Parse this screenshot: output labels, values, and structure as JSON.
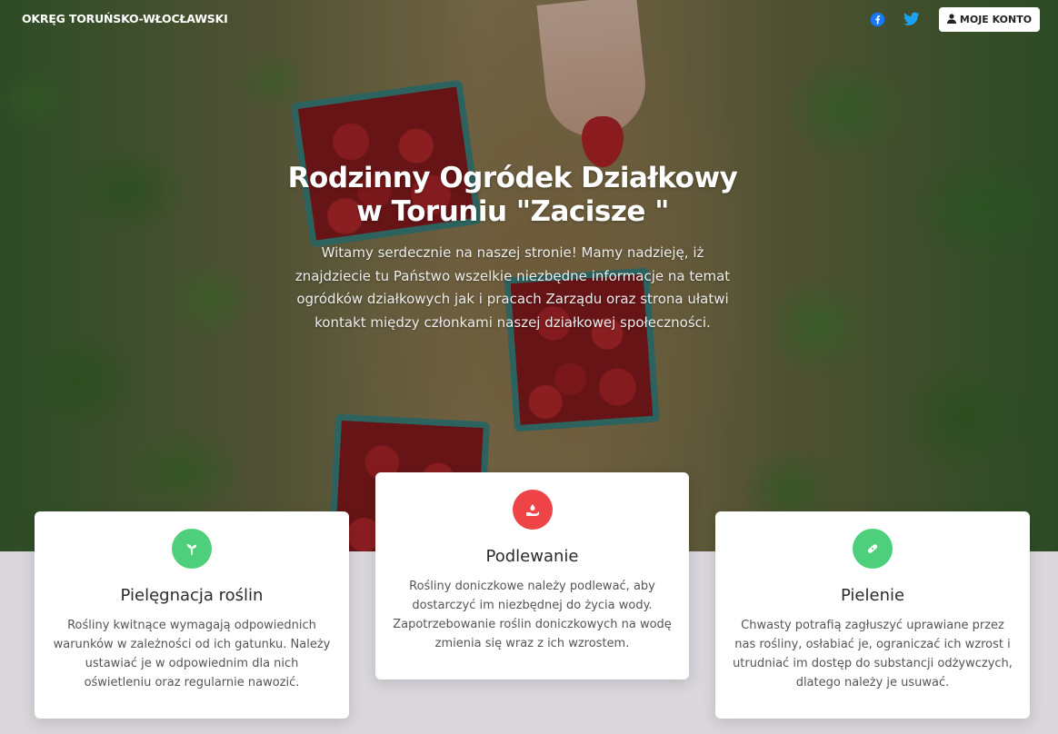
{
  "nav": {
    "brand": "OKRĘG TORUŃSKO-WŁOCŁAWSKI",
    "account_label": "MOJE KONTO",
    "icons": [
      "facebook-icon",
      "twitter-icon",
      "user-icon"
    ],
    "accent_color": "#1877f2",
    "twitter_color": "#1da1f2"
  },
  "hero": {
    "title": "Rodzinny Ogródek Działkowy w Toruniu \"Zacisze \"",
    "text": "Witamy serdecznie na naszej stronie! Mamy nadzieję, iż znajdziecie tu Państwo wszelkie niezbędne informacje na temat ogródków działkowych jak i pracach Zarządu oraz strona ułatwi kontakt między członkami naszej działkowej społeczności."
  },
  "cards": [
    {
      "title": "Pielęgnacja roślin",
      "text": "Rośliny kwitnące wymagają odpowiednich warunków w zależności od ich gatunku. Należy ustawiać je w odpowiednim dla nich oświetleniu oraz regularnie nawozić.",
      "icon": "sprout-icon",
      "color": "#4ecf7c"
    },
    {
      "title": "Podlewanie",
      "text": "Rośliny doniczkowe należy podlewać, aby dostarczyć im niezbędnej do życia wody. Zapotrzebowanie roślin doniczkowych na wodę zmienia się wraz z ich wzrostem.",
      "icon": "watering-icon",
      "color": "#ee4447"
    },
    {
      "title": "Pielenie",
      "text": "Chwasty potrafią zagłuszyć uprawiane przez nas rośliny, osłabiać je, ograniczać ich wzrost i utrudniać im dostęp do substancji odżywczych, dlatego należy je usuwać.",
      "icon": "bandage-icon",
      "color": "#4ecf7c"
    }
  ]
}
